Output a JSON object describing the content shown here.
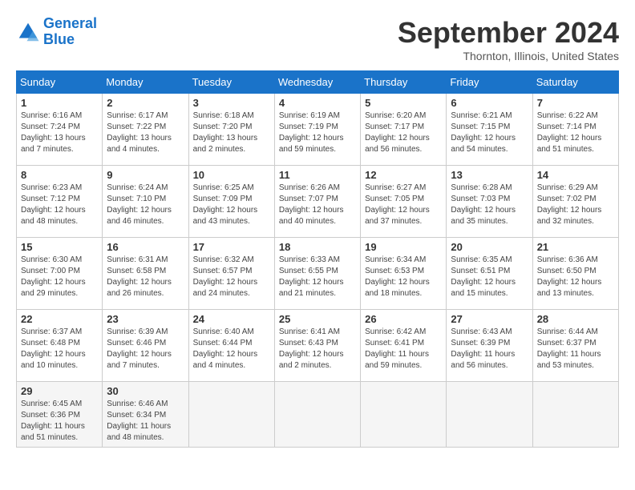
{
  "header": {
    "logo_line1": "General",
    "logo_line2": "Blue",
    "month": "September 2024",
    "location": "Thornton, Illinois, United States"
  },
  "days_of_week": [
    "Sunday",
    "Monday",
    "Tuesday",
    "Wednesday",
    "Thursday",
    "Friday",
    "Saturday"
  ],
  "weeks": [
    [
      {
        "day": "1",
        "sunrise": "6:16 AM",
        "sunset": "7:24 PM",
        "daylight": "13 hours and 7 minutes."
      },
      {
        "day": "2",
        "sunrise": "6:17 AM",
        "sunset": "7:22 PM",
        "daylight": "13 hours and 4 minutes."
      },
      {
        "day": "3",
        "sunrise": "6:18 AM",
        "sunset": "7:20 PM",
        "daylight": "13 hours and 2 minutes."
      },
      {
        "day": "4",
        "sunrise": "6:19 AM",
        "sunset": "7:19 PM",
        "daylight": "12 hours and 59 minutes."
      },
      {
        "day": "5",
        "sunrise": "6:20 AM",
        "sunset": "7:17 PM",
        "daylight": "12 hours and 56 minutes."
      },
      {
        "day": "6",
        "sunrise": "6:21 AM",
        "sunset": "7:15 PM",
        "daylight": "12 hours and 54 minutes."
      },
      {
        "day": "7",
        "sunrise": "6:22 AM",
        "sunset": "7:14 PM",
        "daylight": "12 hours and 51 minutes."
      }
    ],
    [
      {
        "day": "8",
        "sunrise": "6:23 AM",
        "sunset": "7:12 PM",
        "daylight": "12 hours and 48 minutes."
      },
      {
        "day": "9",
        "sunrise": "6:24 AM",
        "sunset": "7:10 PM",
        "daylight": "12 hours and 46 minutes."
      },
      {
        "day": "10",
        "sunrise": "6:25 AM",
        "sunset": "7:09 PM",
        "daylight": "12 hours and 43 minutes."
      },
      {
        "day": "11",
        "sunrise": "6:26 AM",
        "sunset": "7:07 PM",
        "daylight": "12 hours and 40 minutes."
      },
      {
        "day": "12",
        "sunrise": "6:27 AM",
        "sunset": "7:05 PM",
        "daylight": "12 hours and 37 minutes."
      },
      {
        "day": "13",
        "sunrise": "6:28 AM",
        "sunset": "7:03 PM",
        "daylight": "12 hours and 35 minutes."
      },
      {
        "day": "14",
        "sunrise": "6:29 AM",
        "sunset": "7:02 PM",
        "daylight": "12 hours and 32 minutes."
      }
    ],
    [
      {
        "day": "15",
        "sunrise": "6:30 AM",
        "sunset": "7:00 PM",
        "daylight": "12 hours and 29 minutes."
      },
      {
        "day": "16",
        "sunrise": "6:31 AM",
        "sunset": "6:58 PM",
        "daylight": "12 hours and 26 minutes."
      },
      {
        "day": "17",
        "sunrise": "6:32 AM",
        "sunset": "6:57 PM",
        "daylight": "12 hours and 24 minutes."
      },
      {
        "day": "18",
        "sunrise": "6:33 AM",
        "sunset": "6:55 PM",
        "daylight": "12 hours and 21 minutes."
      },
      {
        "day": "19",
        "sunrise": "6:34 AM",
        "sunset": "6:53 PM",
        "daylight": "12 hours and 18 minutes."
      },
      {
        "day": "20",
        "sunrise": "6:35 AM",
        "sunset": "6:51 PM",
        "daylight": "12 hours and 15 minutes."
      },
      {
        "day": "21",
        "sunrise": "6:36 AM",
        "sunset": "6:50 PM",
        "daylight": "12 hours and 13 minutes."
      }
    ],
    [
      {
        "day": "22",
        "sunrise": "6:37 AM",
        "sunset": "6:48 PM",
        "daylight": "12 hours and 10 minutes."
      },
      {
        "day": "23",
        "sunrise": "6:39 AM",
        "sunset": "6:46 PM",
        "daylight": "12 hours and 7 minutes."
      },
      {
        "day": "24",
        "sunrise": "6:40 AM",
        "sunset": "6:44 PM",
        "daylight": "12 hours and 4 minutes."
      },
      {
        "day": "25",
        "sunrise": "6:41 AM",
        "sunset": "6:43 PM",
        "daylight": "12 hours and 2 minutes."
      },
      {
        "day": "26",
        "sunrise": "6:42 AM",
        "sunset": "6:41 PM",
        "daylight": "11 hours and 59 minutes."
      },
      {
        "day": "27",
        "sunrise": "6:43 AM",
        "sunset": "6:39 PM",
        "daylight": "11 hours and 56 minutes."
      },
      {
        "day": "28",
        "sunrise": "6:44 AM",
        "sunset": "6:37 PM",
        "daylight": "11 hours and 53 minutes."
      }
    ],
    [
      {
        "day": "29",
        "sunrise": "6:45 AM",
        "sunset": "6:36 PM",
        "daylight": "11 hours and 51 minutes."
      },
      {
        "day": "30",
        "sunrise": "6:46 AM",
        "sunset": "6:34 PM",
        "daylight": "11 hours and 48 minutes."
      },
      null,
      null,
      null,
      null,
      null
    ]
  ]
}
